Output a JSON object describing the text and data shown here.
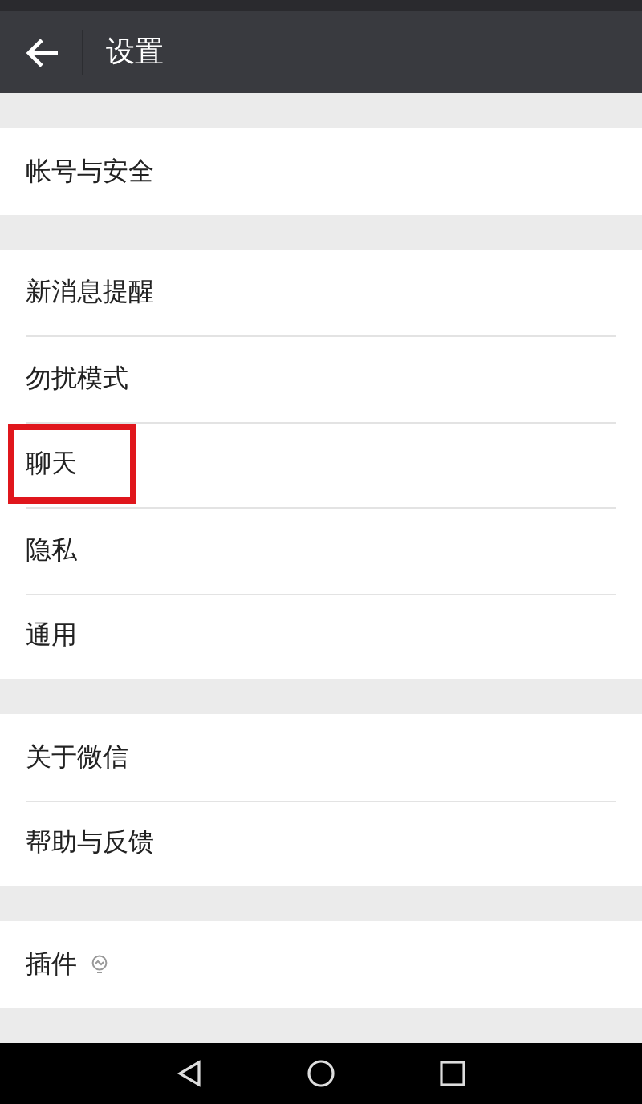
{
  "app_bar": {
    "title": "设置"
  },
  "groups": [
    {
      "items": [
        {
          "label": "帐号与安全",
          "highlighted": false,
          "kind": "plain"
        }
      ]
    },
    {
      "items": [
        {
          "label": "新消息提醒",
          "highlighted": false,
          "kind": "plain"
        },
        {
          "label": "勿扰模式",
          "highlighted": false,
          "kind": "plain"
        },
        {
          "label": "聊天",
          "highlighted": true,
          "kind": "plain"
        },
        {
          "label": "隐私",
          "highlighted": false,
          "kind": "plain"
        },
        {
          "label": "通用",
          "highlighted": false,
          "kind": "plain"
        }
      ]
    },
    {
      "items": [
        {
          "label": "关于微信",
          "highlighted": false,
          "kind": "plain"
        },
        {
          "label": "帮助与反馈",
          "highlighted": false,
          "kind": "plain"
        }
      ]
    },
    {
      "items": [
        {
          "label": "插件",
          "highlighted": false,
          "kind": "iconed"
        }
      ]
    }
  ]
}
